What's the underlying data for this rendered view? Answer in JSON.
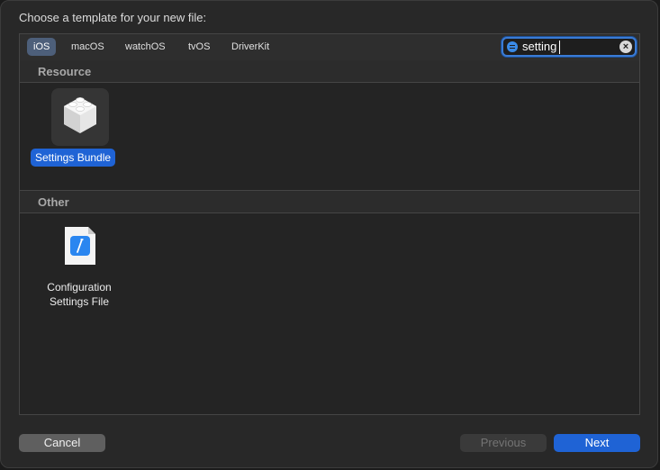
{
  "dialog": {
    "title": "Choose a template for your new file:"
  },
  "tabs": [
    {
      "label": "iOS",
      "selected": true
    },
    {
      "label": "macOS",
      "selected": false
    },
    {
      "label": "watchOS",
      "selected": false
    },
    {
      "label": "tvOS",
      "selected": false
    },
    {
      "label": "DriverKit",
      "selected": false
    }
  ],
  "search": {
    "value": "setting",
    "icon": "filter-icon",
    "clear_icon": "clear-icon"
  },
  "sections": [
    {
      "title": "Resource",
      "templates": [
        {
          "label": "Settings Bundle",
          "icon": "settings-bundle-icon",
          "selected": true
        }
      ]
    },
    {
      "title": "Other",
      "templates": [
        {
          "label_line1": "Configuration",
          "label_line2": "Settings File",
          "icon": "config-settings-file-icon",
          "selected": false
        }
      ]
    }
  ],
  "buttons": {
    "cancel": "Cancel",
    "previous": "Previous",
    "next": "Next",
    "previous_enabled": false
  },
  "colors": {
    "accent": "#1f63d5",
    "selected_tab": "#4d5f7a",
    "background": "#282828"
  }
}
